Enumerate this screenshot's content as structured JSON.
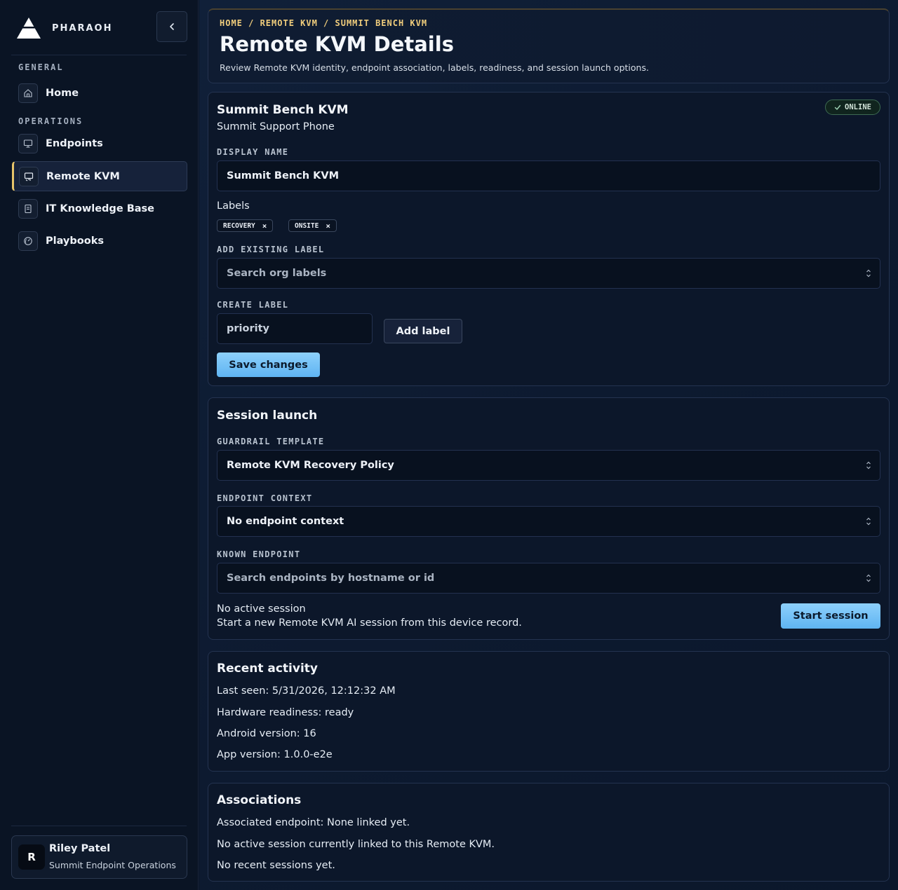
{
  "brand": {
    "name": "PHARAOH"
  },
  "sidebar": {
    "sections": [
      {
        "label": "GENERAL"
      },
      {
        "label": "OPERATIONS"
      }
    ],
    "items": [
      {
        "label": "Home",
        "icon": "home-icon"
      },
      {
        "label": "Endpoints",
        "icon": "monitor-icon"
      },
      {
        "label": "Remote KVM",
        "icon": "remote-screen-icon",
        "active": true
      },
      {
        "label": "IT Knowledge Base",
        "icon": "book-icon"
      },
      {
        "label": "Playbooks",
        "icon": "gauge-icon"
      }
    ]
  },
  "user": {
    "initial": "R",
    "name": "Riley Patel",
    "org": "Summit Endpoint Operations"
  },
  "header": {
    "breadcrumb": "HOME / REMOTE KVM / SUMMIT BENCH KVM",
    "title": "Remote KVM Details",
    "subtitle": "Review Remote KVM identity, endpoint association, labels, readiness, and session launch options."
  },
  "device": {
    "name": "Summit Bench KVM",
    "subtitle": "Summit Support Phone",
    "status": "ONLINE",
    "display_name_label": "DISPLAY NAME",
    "display_name_value": "Summit Bench KVM",
    "labels_heading": "Labels",
    "labels": [
      "RECOVERY",
      "ONSITE"
    ],
    "add_existing_label": "ADD EXISTING LABEL",
    "add_existing_placeholder": "Search org labels",
    "create_label": "CREATE LABEL",
    "create_label_value": "priority",
    "add_label_button": "Add label",
    "save_button": "Save changes"
  },
  "session": {
    "title": "Session launch",
    "guardrail_label": "GUARDRAIL TEMPLATE",
    "guardrail_value": "Remote KVM Recovery Policy",
    "endpoint_context_label": "ENDPOINT CONTEXT",
    "endpoint_context_value": "No endpoint context",
    "known_endpoint_label": "KNOWN ENDPOINT",
    "known_endpoint_placeholder": "Search endpoints by hostname or id",
    "status_line": "No active session",
    "status_desc": "Start a new Remote KVM AI session from this device record.",
    "start_button": "Start session"
  },
  "activity": {
    "title": "Recent activity",
    "lines": [
      "Last seen: 5/31/2026, 12:12:32 AM",
      "Hardware readiness: ready",
      "Android version: 16",
      "App version: 1.0.0-e2e"
    ]
  },
  "associations": {
    "title": "Associations",
    "lines": [
      "Associated endpoint: None linked yet.",
      "No active session currently linked to this Remote KVM.",
      "No recent sessions yet."
    ]
  },
  "colors": {
    "accent": "#e7c46a",
    "primary": "#6ec0f6",
    "online": "#3d6a52"
  }
}
